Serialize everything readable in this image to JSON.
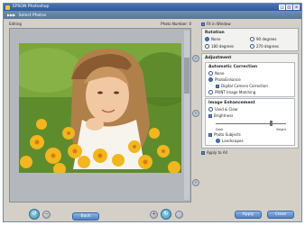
{
  "window": {
    "title": "EPSON Photoshop",
    "controls": [
      "_",
      "□",
      "×"
    ]
  },
  "steps": {
    "label": "Select Photos"
  },
  "subheader": {
    "left": "Editing",
    "right": "Photo Number: 0"
  },
  "panel": {
    "fit_window": "Fit in Window",
    "rotation": {
      "title": "Rotation",
      "options": [
        "None",
        "90 degrees",
        "180 degrees",
        "270 degrees"
      ]
    },
    "adjustment": {
      "title": "Adjustment",
      "auto_correction": {
        "title": "Automatic Correction",
        "none": "None",
        "photoenhance": "PhotoEnhance",
        "digital_camera": "Digital Camera Correction",
        "print_matching": "PRINT Image Matching"
      },
      "enhancement": {
        "title": "Image Enhancement",
        "vivid": "Vivid & Clear",
        "brightness": "Brightness",
        "dark": "Dark",
        "bright": "Bright",
        "brightness_level": 0.72,
        "photo_subjects": "Photo Subjects",
        "landscapes": "Landscapes"
      }
    },
    "apply_all": "Apply to All"
  },
  "buttons": {
    "back": "Back",
    "apply": "Apply",
    "close": "Close"
  },
  "colors": {
    "titlebar": "#3d6aa8",
    "steps": "#62829f",
    "accent": "#4e80c4"
  }
}
